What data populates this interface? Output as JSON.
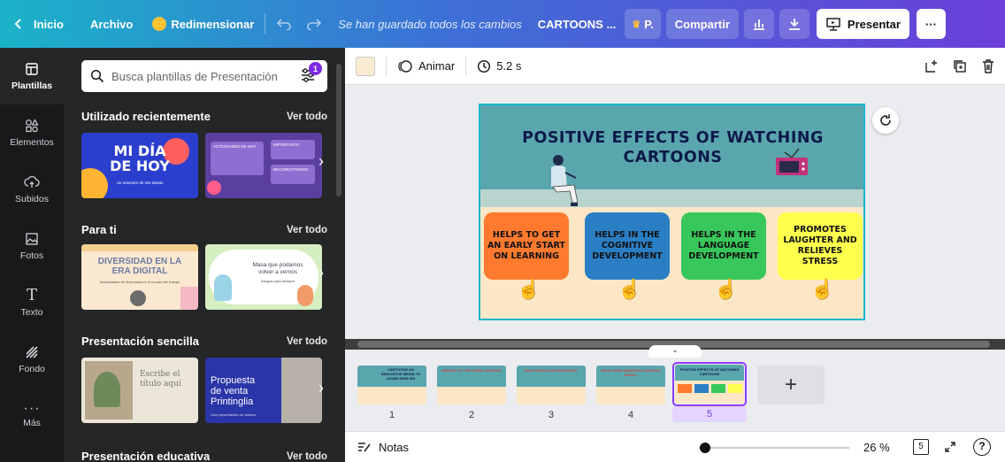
{
  "topbar": {
    "back_label": "Inicio",
    "file_label": "Archivo",
    "resize_label": "Redimensionar",
    "saved_status": "Se han guardado todos los cambios",
    "doc_title": "CARTOONS ...",
    "pro_label": "P.",
    "share_label": "Compartir",
    "present_label": "Presentar",
    "more_label": "···"
  },
  "rail": {
    "items": [
      {
        "label": "Plantillas",
        "icon": "template-icon"
      },
      {
        "label": "Elementos",
        "icon": "elements-icon"
      },
      {
        "label": "Subidos",
        "icon": "upload-icon"
      },
      {
        "label": "Fotos",
        "icon": "photo-icon"
      },
      {
        "label": "Texto",
        "icon": "text-icon"
      },
      {
        "label": "Fondo",
        "icon": "background-icon"
      },
      {
        "label": "Más",
        "icon": "more-icon"
      }
    ]
  },
  "panel": {
    "search_placeholder": "Busca plantillas de Presentación",
    "filter_badge": "1",
    "sections": [
      {
        "title": "Utilizado recientemente",
        "see_all": "Ver todo",
        "thumb1": {
          "line1": "MI DÍA",
          "line2": "DE HOY",
          "sub": "Un resumen de mis tareas"
        },
        "thumb2": {
          "label1": "IMPORTANTE",
          "label2": "ACTIVIDADES DE HOY",
          "label3": "RECORDATORIOS"
        }
      },
      {
        "title": "Para ti",
        "see_all": "Ver todo",
        "thumb1": {
          "line1": "DIVERSIDAD EN LA",
          "line2": "ERA DIGITAL",
          "sub": "Modalidades de diversidad en el mundo del trabajo"
        },
        "thumb2": {
          "line1": "Masa que podamos",
          "line2": "volver a vernos",
          "sub": "Amigos para siempre"
        }
      },
      {
        "title": "Presentación sencilla",
        "see_all": "Ver todo",
        "thumb1": {
          "line1": "Escribe el",
          "line2": "título aquí"
        },
        "thumb2": {
          "line1": "Propuesta",
          "line2": "de venta",
          "line3": "Printinglia",
          "sub": "Una presentación de Juliana"
        }
      },
      {
        "title": "Presentación educativa",
        "see_all": "Ver todo"
      }
    ]
  },
  "editor_toolbar": {
    "swatch_color": "#f9ebd2",
    "animate_label": "Animar",
    "duration_label": "5.2 s"
  },
  "slide": {
    "title_line1": "POSITIVE EFFECTS OF WATCHING",
    "title_line2": "CARTOONS",
    "cards": [
      {
        "text": "HELPS TO GET AN EARLY START ON LEARNING",
        "color": "#ff7a2e"
      },
      {
        "text": "HELPS IN THE COGNITIVE DEVELOPMENT",
        "color": "#2a7ec4"
      },
      {
        "text": "HELPS IN THE LANGUAGE DEVELOPMENT",
        "color": "#37c75a"
      },
      {
        "text": "PROMOTES LAUGHTER AND RELIEVES STRESS",
        "color": "#ffff4d"
      }
    ]
  },
  "pages": [
    {
      "num": "1",
      "title": "CARTOONS AN INNOVATIVE MEDIA TO LEARN ENGLISH"
    },
    {
      "num": "2",
      "title": "HISTORY OF THE TERM CARTOON"
    },
    {
      "num": "3",
      "title": "WHAT DOES CARTOON MEAN?"
    },
    {
      "num": "4",
      "title": "WHAT DOES ANIMATED CARTOON MEAN?"
    },
    {
      "num": "5",
      "title": "POSITIVE EFFECTS OF WATCHING CARTOONS"
    }
  ],
  "add_page_label": "+",
  "bottombar": {
    "notes_label": "Notas",
    "zoom_label": "26 %",
    "page_count": "5",
    "help_label": "?",
    "zoom_percent": 26
  },
  "colors": {
    "brand_gradient_start": "#1ab3c8",
    "brand_gradient_end": "#6b3fd9",
    "accent": "#8b3dff"
  }
}
